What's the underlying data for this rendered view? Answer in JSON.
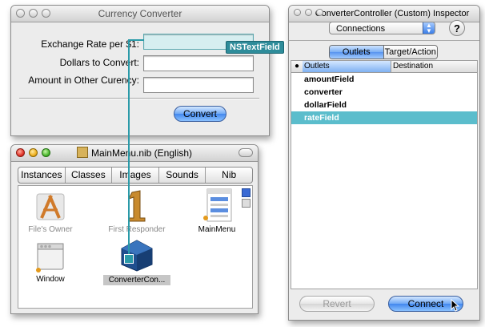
{
  "currency_window": {
    "title": "Currency Converter",
    "labels": {
      "rate": "Exchange Rate per $1:",
      "dollars": "Dollars to Convert:",
      "amount": "Amount in Other Curency:"
    },
    "convert_label": "Convert",
    "connection_tag": "NSTextField"
  },
  "nib_window": {
    "title": "MainMenu.nib (English)",
    "tabs": [
      "Instances",
      "Classes",
      "Images",
      "Sounds",
      "Nib"
    ],
    "items": {
      "files_owner": "File's Owner",
      "first_responder": "First Responder",
      "main_menu": "MainMenu",
      "window": "Window",
      "converter": "ConverterCon..."
    }
  },
  "inspector": {
    "title": "ConverterController (Custom) Inspector",
    "popup_value": "Connections",
    "help_label": "?",
    "segments": [
      "Outlets",
      "Target/Action"
    ],
    "columns": [
      "Outlets",
      "Destination"
    ],
    "outlets": [
      "amountField",
      "converter",
      "dollarField",
      "rateField"
    ],
    "selected_outlet": "rateField",
    "revert_label": "Revert",
    "connect_label": "Connect"
  },
  "colors": {
    "connection": "#2a9aa8",
    "selection": "#5bbdcc",
    "aqua_blue": "#4287ee"
  }
}
